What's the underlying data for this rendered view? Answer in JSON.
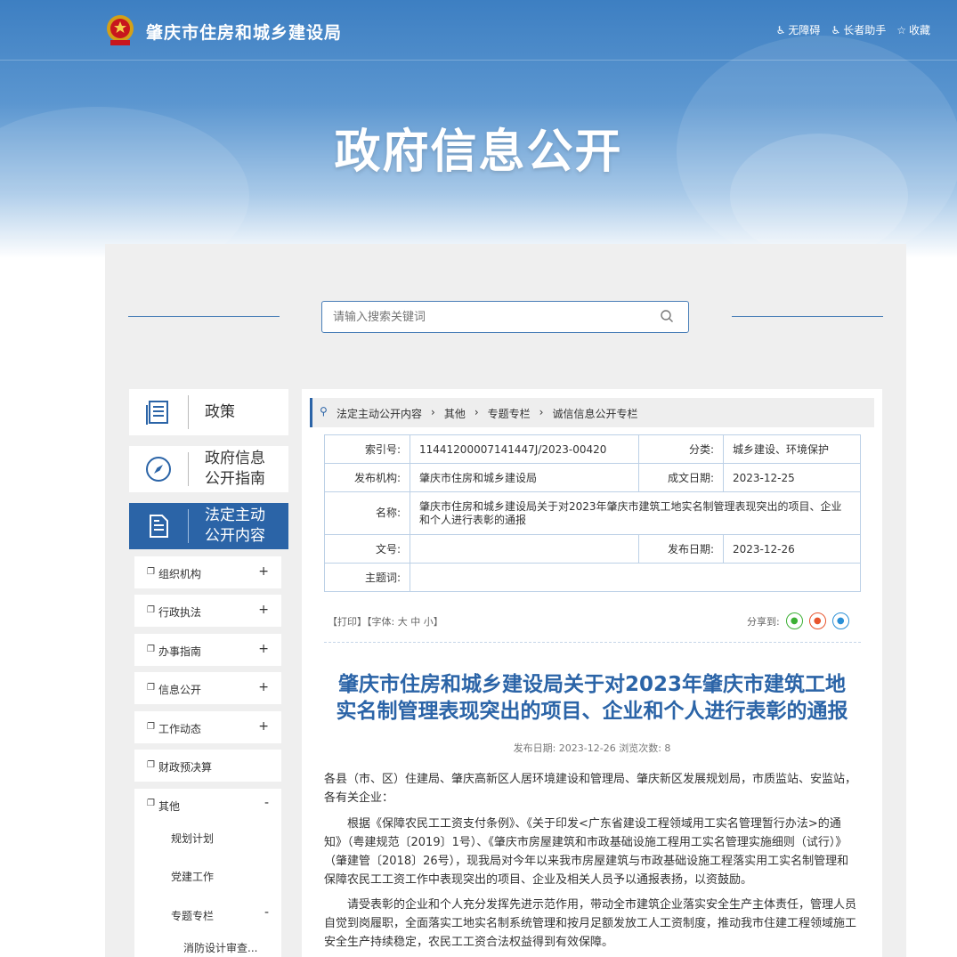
{
  "header": {
    "site_name": "肇庆市住房和城乡建设局",
    "links": [
      {
        "icon": "accessibility-icon",
        "label": "无障碍"
      },
      {
        "icon": "elder-helper-icon",
        "label": "长者助手"
      },
      {
        "icon": "star-icon",
        "label": "收藏"
      }
    ],
    "banner_title": "政府信息公开"
  },
  "search": {
    "placeholder": "请输入搜索关键词"
  },
  "sidebar": {
    "cards": [
      {
        "label": "政策",
        "icon": "document-icon"
      },
      {
        "label": "政府信息公开指南",
        "label_line1": "政府信息",
        "label_line2": "公开指南",
        "icon": "compass-icon"
      },
      {
        "label": "法定主动公开内容",
        "label_line1": "法定主动",
        "label_line2": "公开内容",
        "icon": "file-list-icon"
      }
    ],
    "menu": [
      {
        "label": "组织机构",
        "toggle": "+"
      },
      {
        "label": "行政执法",
        "toggle": "+"
      },
      {
        "label": "办事指南",
        "toggle": "+"
      },
      {
        "label": "信息公开",
        "toggle": "+"
      },
      {
        "label": "工作动态",
        "toggle": "+"
      },
      {
        "label": "财政预决算",
        "toggle": ""
      },
      {
        "label": "其他",
        "toggle": "-"
      }
    ],
    "sub_items": [
      "规划计划",
      "党建工作",
      "专题专栏"
    ],
    "sub_toggle": "-",
    "sub_sub_items": [
      "消防设计审查..."
    ]
  },
  "breadcrumb": [
    "法定主动公开内容",
    "其他",
    "专题专栏",
    "诚信信息公开专栏"
  ],
  "breadcrumb_sep": "›",
  "meta_table": {
    "index_label": "索引号:",
    "index_value": "11441200007141447J/2023-00420",
    "category_label": "分类:",
    "category_value": "城乡建设、环境保护",
    "publisher_label": "发布机构:",
    "publisher_value": "肇庆市住房和城乡建设局",
    "created_label": "成文日期:",
    "created_value": "2023-12-25",
    "name_label": "名称:",
    "name_value": "肇庆市住房和城乡建设局关于对2023年肇庆市建筑工地实名制管理表现突出的项目、企业和个人进行表彰的通报",
    "docno_label": "文号:",
    "docno_value": "",
    "pubdate_label": "发布日期:",
    "pubdate_value": "2023-12-26",
    "subject_label": "主题词:",
    "subject_value": ""
  },
  "tools": {
    "text": "【打印】【字体: 大 中 小】"
  },
  "share": {
    "label": "分享到:"
  },
  "article": {
    "title_line1": "肇庆市住房和城乡建设局关于对2023年肇庆市建筑工地",
    "title_line2": "实名制管理表现突出的项目、企业和个人进行表彰的通报",
    "meta": "发布日期: 2023-12-26  浏览次数: 8",
    "p1": "各县（市、区）住建局、肇庆高新区人居环境建设和管理局、肇庆新区发展规划局，市质监站、安监站，各有关企业：",
    "p2": "根据《保障农民工工资支付条例》、《关于印发<广东省建设工程领域用工实名管理暂行办法>的通知》（粤建规范〔2019〕1号）、《肇庆市房屋建筑和市政基础设施工程用工实名管理实施细则（试行）》（肇建管〔2018〕26号），现我局对今年以来我市房屋建筑与市政基础设施工程落实用工实名制管理和保障农民工工资工作中表现突出的项目、企业及相关人员予以通报表扬，以资鼓励。",
    "p3": "请受表彰的企业和个人充分发挥先进示范作用，带动全市建筑企业落实安全生产主体责任，管理人员自觉到岗履职，全面落实工地实名制系统管理和按月足额发放工人工资制度，推动我市住建工程领域施工安全生产持续稳定，农民工工资合法权益得到有效保障。"
  },
  "colors": {
    "brand_blue": "#2b64a7",
    "banner_top": "#3d7fc2",
    "panel_gray": "#efefef"
  }
}
